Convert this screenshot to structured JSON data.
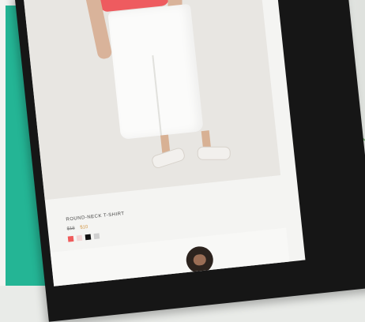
{
  "product": {
    "name": "ROUND-NECK T-SHIRT",
    "old_price": "$18",
    "sale_price": "$10",
    "swatches": [
      "#ef5b5b",
      "#f2d6d6",
      "#121212",
      "#cfcfcf"
    ]
  },
  "colors": {
    "frame": "#24b595",
    "tablet": "#161616",
    "screen": "#f4f4f2"
  }
}
